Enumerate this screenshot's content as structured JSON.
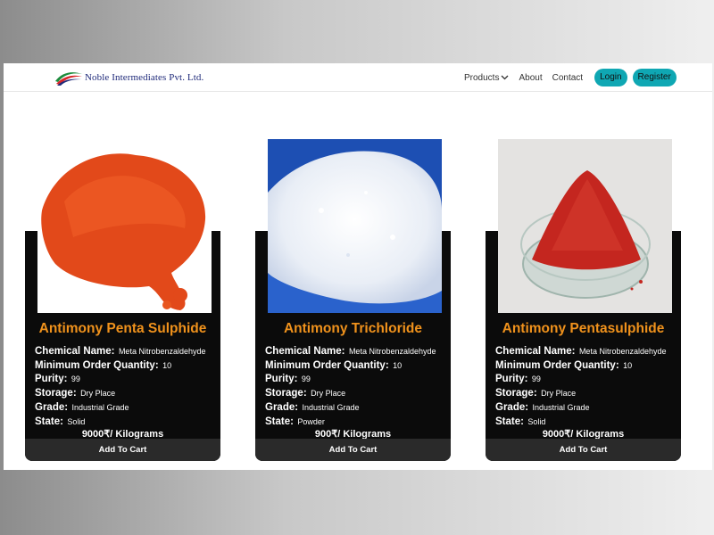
{
  "brand": {
    "name": "Noble Intermediates Pvt. Ltd.",
    "logo_icon": "swoosh-logo-icon"
  },
  "nav": {
    "products": "Products",
    "about": "About",
    "contact": "Contact",
    "login": "Login",
    "register": "Register"
  },
  "products": [
    {
      "title": "Antimony Penta Sulphide",
      "image": "orange-powder-pile",
      "specs": [
        {
          "key": "Chemical Name:",
          "value": "Meta Nitrobenzaldehyde"
        },
        {
          "key": "Minimum Order Quantity:",
          "value": "10"
        },
        {
          "key": "Purity:",
          "value": "99"
        },
        {
          "key": "Storage:",
          "value": "Dry Place"
        },
        {
          "key": "Grade:",
          "value": "Industrial Grade"
        },
        {
          "key": "State:",
          "value": "Solid"
        }
      ],
      "price": "9000₹/ Kilograms",
      "cart": "Add To Cart"
    },
    {
      "title": "Antimony Trichloride",
      "image": "white-crystals-on-blue",
      "specs": [
        {
          "key": "Chemical Name:",
          "value": "Meta Nitrobenzaldehyde"
        },
        {
          "key": "Minimum Order Quantity:",
          "value": "10"
        },
        {
          "key": "Purity:",
          "value": "99"
        },
        {
          "key": "Storage:",
          "value": "Dry Place"
        },
        {
          "key": "Grade:",
          "value": "Industrial Grade"
        },
        {
          "key": "State:",
          "value": "Powder"
        }
      ],
      "price": "900₹/ Kilograms",
      "cart": "Add To Cart"
    },
    {
      "title": "Antimony Pentasulphide",
      "image": "red-powder-in-glass-dish",
      "specs": [
        {
          "key": "Chemical Name:",
          "value": "Meta Nitrobenzaldehyde"
        },
        {
          "key": "Minimum Order Quantity:",
          "value": "10"
        },
        {
          "key": "Purity:",
          "value": "99"
        },
        {
          "key": "Storage:",
          "value": "Dry Place"
        },
        {
          "key": "Grade:",
          "value": "Industrial Grade"
        },
        {
          "key": "State:",
          "value": "Solid"
        }
      ],
      "price": "9000₹/ Kilograms",
      "cart": "Add To Cart"
    }
  ],
  "chat": {
    "icon": "chat-bubble-icon"
  },
  "colors": {
    "accent_teal": "#0fa7b3",
    "title_orange": "#f0921c",
    "card_bg": "#0b0b0b",
    "chat_blue": "#3a86e8"
  }
}
